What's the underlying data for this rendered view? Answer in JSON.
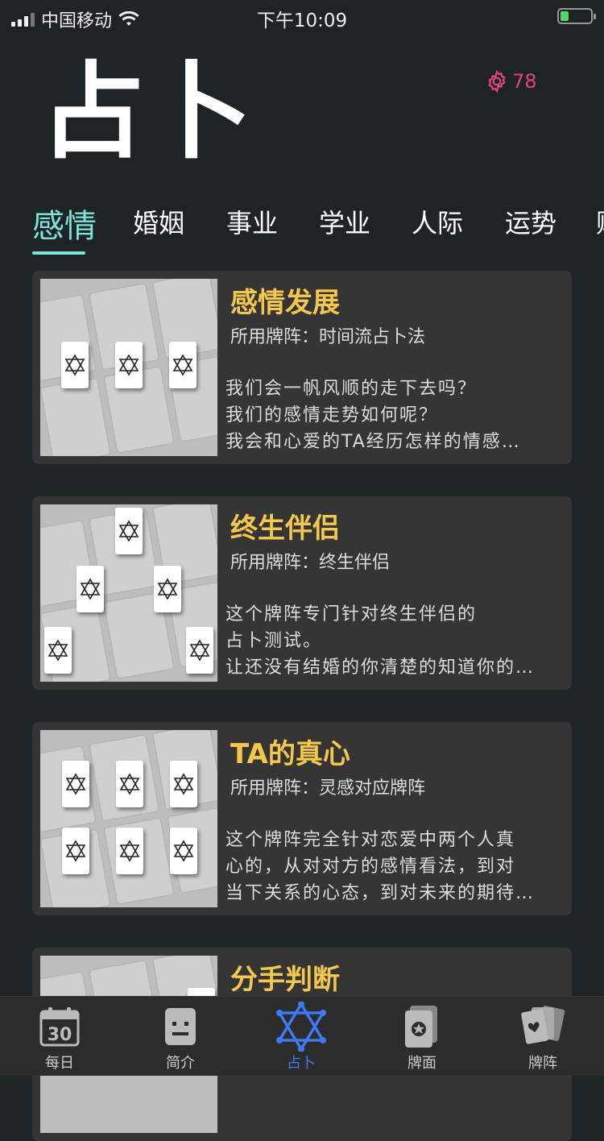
{
  "status_bar": {
    "carrier": "中国移动",
    "time": "下午10:09"
  },
  "header": {
    "title": "占卜",
    "points": "78"
  },
  "tabs": [
    "感情",
    "婚姻",
    "事业",
    "学业",
    "人际",
    "运势",
    "财"
  ],
  "cards": [
    {
      "title": "感情发展",
      "subtitle": "所用牌阵：时间流占卜法",
      "desc": [
        "我们会一帆风顺的走下去吗？",
        "我们的感情走势如何呢？",
        "我会和心爱的TA经历怎样的情感…"
      ]
    },
    {
      "title": "终生伴侣",
      "subtitle": "所用牌阵：终生伴侣",
      "desc": [
        "这个牌阵专门针对终生伴侣的",
        "占卜测试。",
        "让还没有结婚的你清楚的知道你的…"
      ]
    },
    {
      "title": "TA的真心",
      "subtitle": "所用牌阵：灵感对应牌阵",
      "desc": [
        "这个牌阵完全针对恋爱中两个人真",
        "心的，从对对方的感情看法，到对",
        "当下关系的心态，到对未来的期待…"
      ]
    },
    {
      "title": "分手判断",
      "subtitle": "",
      "desc": []
    }
  ],
  "tabbar": [
    {
      "label": "每日",
      "icon": "calendar-icon",
      "badge": "30"
    },
    {
      "label": "简介",
      "icon": "intro-icon"
    },
    {
      "label": "占卜",
      "icon": "hexagram-icon",
      "active": true
    },
    {
      "label": "牌面",
      "icon": "card-face-icon"
    },
    {
      "label": "牌阵",
      "icon": "card-spread-icon"
    }
  ],
  "colors": {
    "background": "#1e2326",
    "accent_tab": "#7be3d9",
    "title_gold": "#f5c84c",
    "active_blue": "#3d7bf5",
    "points_pink": "#e0447c"
  }
}
